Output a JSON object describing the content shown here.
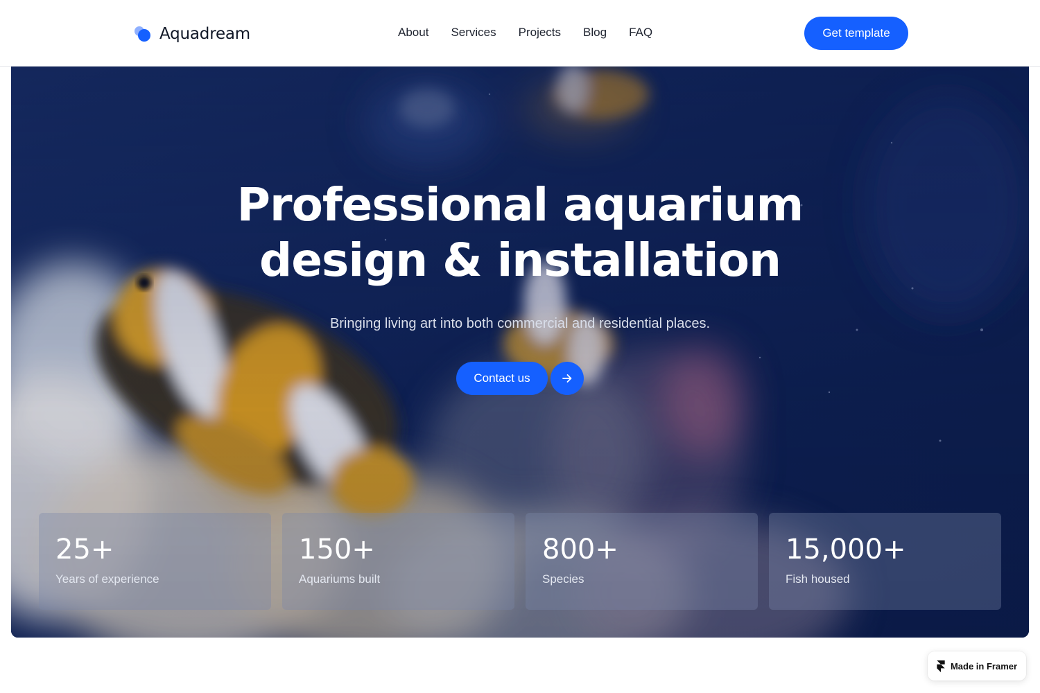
{
  "header": {
    "brand_name": "Aquadream",
    "nav": [
      "About",
      "Services",
      "Projects",
      "Blog",
      "FAQ"
    ],
    "cta_label": "Get template"
  },
  "hero": {
    "title_line1": "Professional aquarium",
    "title_line2": "design & installation",
    "subtitle": "Bringing living art into both commercial and residential places.",
    "contact_label": "Contact us",
    "arrow_icon": "arrow-right-icon",
    "stats": [
      {
        "value": "25+",
        "label": "Years of experience"
      },
      {
        "value": "150+",
        "label": "Aquariums built"
      },
      {
        "value": "800+",
        "label": "Species"
      },
      {
        "value": "15,000+",
        "label": "Fish housed"
      }
    ]
  },
  "badge": {
    "label": "Made in Framer",
    "icon": "framer-logo-icon"
  },
  "colors": {
    "accent": "#1560ff",
    "hero_bg": "#0d1c48",
    "text_dark": "#111827"
  }
}
